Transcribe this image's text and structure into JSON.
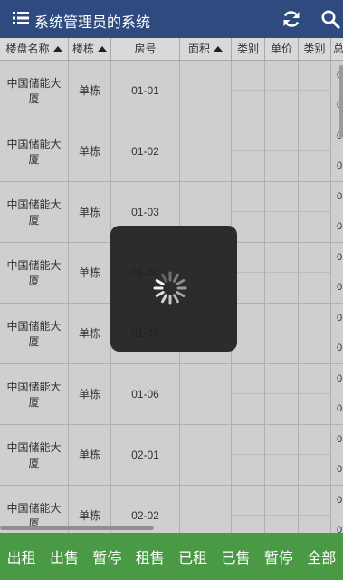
{
  "header": {
    "title": "系统管理员的系统",
    "menu_icon": "list-icon",
    "refresh_icon": "refresh-icon",
    "search_icon": "search-icon"
  },
  "table": {
    "columns": [
      {
        "label": "楼盘名称",
        "sortable": true
      },
      {
        "label": "楼栋",
        "sortable": true
      },
      {
        "label": "房号",
        "sortable": false
      },
      {
        "label": "面积",
        "sortable": true
      },
      {
        "label": "类别",
        "sortable": false
      },
      {
        "label": "单价",
        "sortable": false
      },
      {
        "label": "类别",
        "sortable": false
      },
      {
        "label": "总",
        "sortable": false
      }
    ],
    "rows": [
      {
        "project": "中国储能大厦",
        "building": "单栋",
        "room": "01-01",
        "edge_top": "0",
        "edge_bottom": "0"
      },
      {
        "project": "中国储能大厦",
        "building": "单栋",
        "room": "01-02",
        "edge_top": "0",
        "edge_bottom": "0"
      },
      {
        "project": "中国储能大厦",
        "building": "单栋",
        "room": "01-03",
        "edge_top": "0",
        "edge_bottom": "0"
      },
      {
        "project": "中国储能大厦",
        "building": "单栋",
        "room": "01-04",
        "edge_top": "0",
        "edge_bottom": "0"
      },
      {
        "project": "中国储能大厦",
        "building": "单栋",
        "room": "01-05",
        "edge_top": "0",
        "edge_bottom": "0"
      },
      {
        "project": "中国储能大厦",
        "building": "单栋",
        "room": "01-06",
        "edge_top": "0",
        "edge_bottom": "0"
      },
      {
        "project": "中国储能大厦",
        "building": "单栋",
        "room": "02-01",
        "edge_top": "0",
        "edge_bottom": "0"
      },
      {
        "project": "中国储能大厦",
        "building": "单栋",
        "room": "02-02",
        "edge_top": "0",
        "edge_bottom": "0"
      }
    ]
  },
  "loading": {
    "icon": "spinner-icon"
  },
  "bottom_tabs": [
    "出租",
    "出售",
    "暂停",
    "租售",
    "已租",
    "已售",
    "暂停",
    "全部"
  ],
  "colors": {
    "header": "#2e4a7f",
    "bottom_bar": "#4a9a45",
    "overlay": "#1e1e1e"
  }
}
